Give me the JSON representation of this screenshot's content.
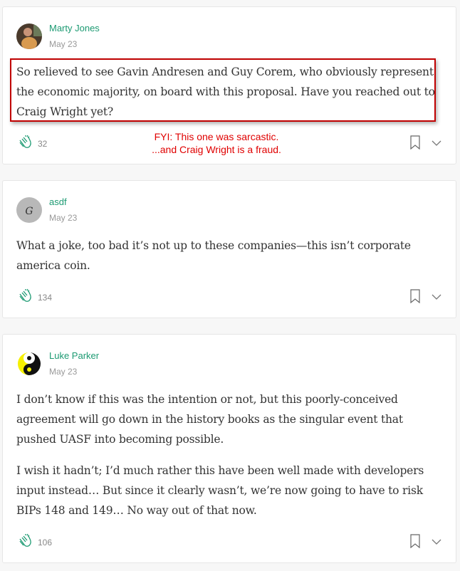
{
  "accent": "#1c9a72",
  "annotation_color": "#e00000",
  "comments": [
    {
      "author": "Marty Jones",
      "date": "May 23",
      "paragraphs": [
        "So relieved to see Gavin Andresen and Guy Corem, who obviously represent the economic majority, on board with this proposal. Have you reached out to Craig Wright yet?"
      ],
      "claps": "32",
      "annotation": [
        "FYI: This one was sarcastic.",
        "...and Craig Wright is a fraud."
      ]
    },
    {
      "author": "asdf",
      "date": "May 23",
      "paragraphs": [
        "What a joke, too bad it’s not up to these companies—this isn’t corporate america coin."
      ],
      "claps": "134"
    },
    {
      "author": "Luke Parker",
      "date": "May 23",
      "paragraphs": [
        "I don’t know if this was the intention or not, but this poorly-conceived agreement will go down in the history books as the singular event that pushed UASF into becoming possible.",
        "I wish it hadn’t; I’d much rather this have been well made with developers input instead… But since it clearly wasn’t, we’re now going to have to risk BIPs 148 and 149… No way out of that now."
      ],
      "claps": "106"
    }
  ],
  "icons": {
    "clap": "clap-icon",
    "bookmark": "bookmark-icon",
    "more": "chevron-down-icon"
  }
}
